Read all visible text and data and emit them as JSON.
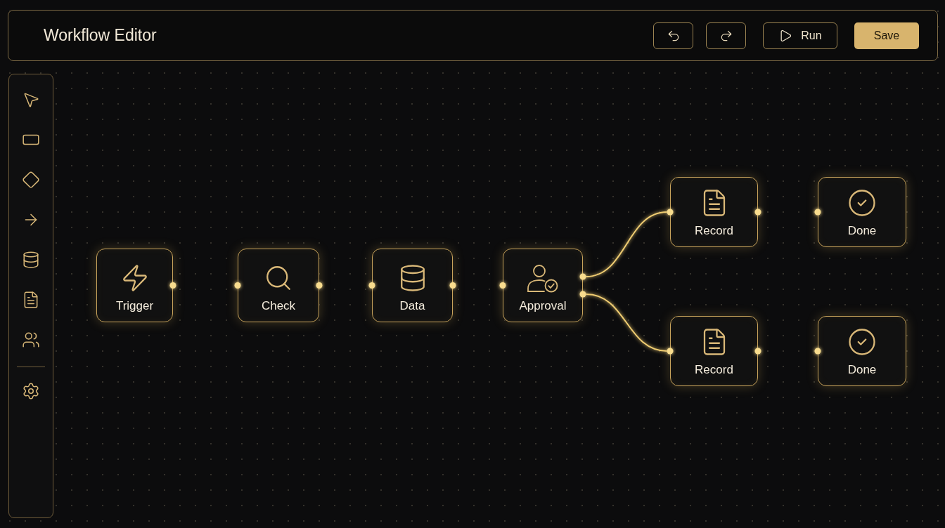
{
  "header": {
    "title": "Workflow Editor",
    "buttons": [
      {
        "kind": "undo"
      },
      {
        "kind": "redo"
      },
      {
        "kind": "run",
        "label": "Run"
      },
      {
        "kind": "save",
        "label": "Save"
      }
    ]
  },
  "sidebar": {
    "tools": [
      {
        "kind": "select"
      },
      {
        "kind": "rectangle"
      },
      {
        "kind": "decision"
      },
      {
        "kind": "connector"
      },
      {
        "kind": "database"
      },
      {
        "kind": "document"
      },
      {
        "kind": "users"
      }
    ],
    "footer_tools": [
      {
        "kind": "settings"
      }
    ]
  },
  "canvas": {
    "flow": [
      {
        "label": "Trigger"
      },
      {
        "label": "Check"
      },
      {
        "label": "Data"
      },
      {
        "label": "Approval"
      }
    ],
    "branches": [
      {
        "nodes": [
          {
            "label": "Record"
          },
          {
            "label": "Done"
          }
        ]
      },
      {
        "nodes": [
          {
            "label": "Record"
          },
          {
            "label": "Done"
          }
        ]
      }
    ]
  }
}
